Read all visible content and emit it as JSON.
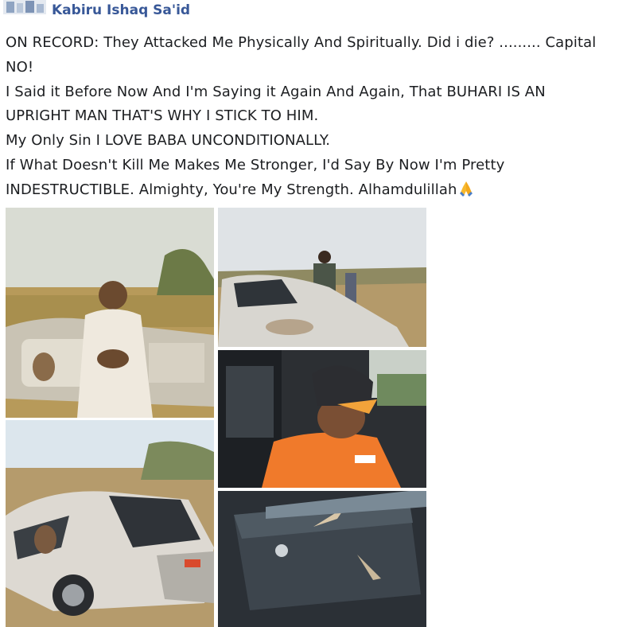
{
  "post": {
    "author": "Kabiru Ishaq Sa'id",
    "lines": [
      "ON RECORD: They Attacked Me Physically And Spiritually. Did i die? .........   Capital",
      "NO!",
      "I Said it Before Now And I'm Saying it Again And Again, That BUHARI IS AN",
      "UPRIGHT MAN THAT'S WHY I STICK TO HIM.",
      "My Only Sin I LOVE BABA UNCONDITIONALLY.",
      "If What Doesn't Kill Me Makes Me Stronger, I'd Say By Now I'm Pretty",
      "INDESTRUCTIBLE.  Almighty, You're My Strength. Alhamdulillah"
    ],
    "end_emoji": "folded-hands-emoji"
  },
  "photos": [
    {
      "name": "photo-man-by-damaged-car"
    },
    {
      "name": "photo-damaged-car-field"
    },
    {
      "name": "photo-man-orange-shirt"
    },
    {
      "name": "photo-overturned-car"
    },
    {
      "name": "photo-shattered-car-window"
    }
  ],
  "colors": {
    "author": "#385898",
    "text": "#1c1e21",
    "background": "#ffffff"
  }
}
